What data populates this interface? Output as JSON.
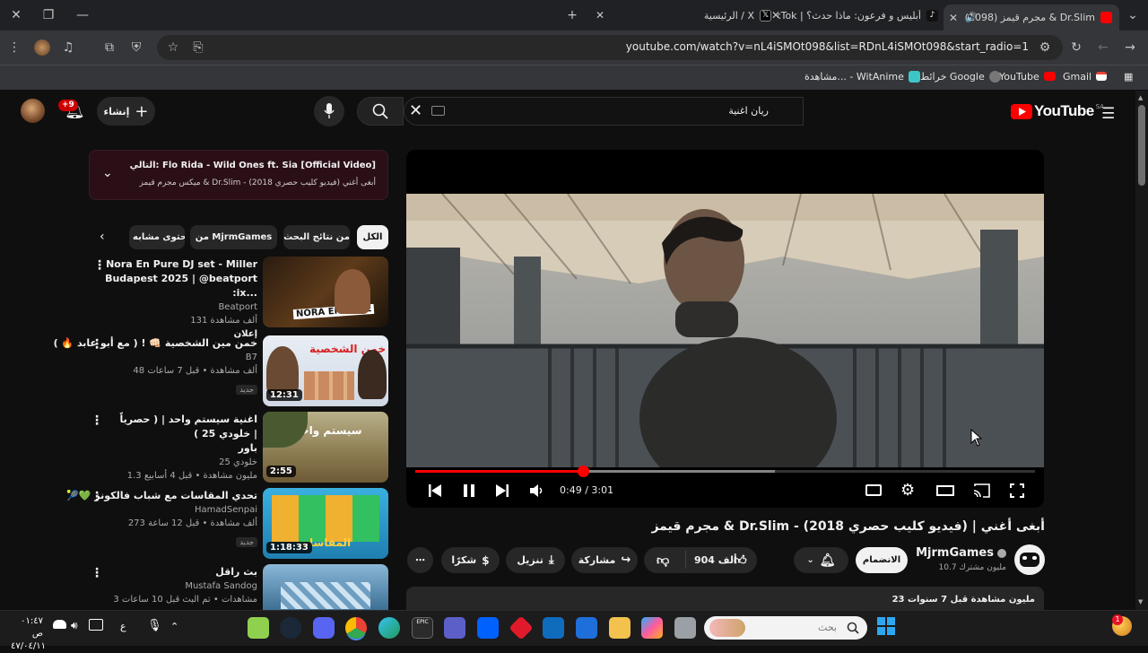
{
  "browser": {
    "tabs": [
      {
        "label": "(1098) مجرم قيمز & Dr.Slim",
        "active": true
      },
      {
        "label": "أبليس و فرعون: ماذا حدث؟ | TikTok"
      },
      {
        "label": "الرئيسية / X"
      }
    ],
    "url": "youtube.com/watch?v=nL4iSMOt098&list=RDnL4iSMOt098&start_radio=1",
    "bookmarks": [
      "Gmail",
      "YouTube",
      "خرائط Google",
      "مشاهدة... - WitAnime"
    ]
  },
  "youtube": {
    "logo_text": "YouTube",
    "region": "SA",
    "search_query": "ريان اغنية",
    "create_label": "إنشاء",
    "notif_count": "+9"
  },
  "player": {
    "time": "0:49 / 3:01",
    "progress": 0.27,
    "buffered": 0.58
  },
  "video": {
    "title": "مجرم قيمز & Dr.Slim - أبغى أغني | (فيديو كليب حصري 2018)",
    "channel": "MjrmGames",
    "subscribers": "10.7 مليون مشترك",
    "subscribe_label": "الانضمام",
    "likes": "904 ألف",
    "share_label": "مشاركة",
    "download_label": "تنزيل",
    "thanks_label": "شكرًا",
    "views": "23 مليون مشاهدة  قبل 7 سنوات"
  },
  "up_next": {
    "title": "التالي: Flo Rida - Wild Ones ft. Sia [Official Video]",
    "subtitle": "ميكس مجرم قيمز & Dr.Slim - أبغى أغني (فيديو كليب حصري 2018)"
  },
  "chips": [
    "الكل",
    "من نتائج البحث",
    "من MjrmGames",
    "محتوى مشابه"
  ],
  "recommendations": [
    {
      "title1": "Nora En Pure DJ set - Miller",
      "title2": "Budapest 2025 | @beatport :ix...",
      "channel": "Beatport",
      "meta": "131 ألف مشاهدة",
      "badge": "إعلان",
      "duration": "",
      "thumb_text": "NORA EN PURE"
    },
    {
      "title1": "خمن مين الشخصية 👊🏻 ! ( مع أبو عابد 🔥 )",
      "title2": "",
      "channel": "B7",
      "meta": "48 ألف مشاهدة • قبل 7 ساعات",
      "badge": "جديد",
      "duration": "12:31",
      "thumb_text": "خمن الشخصية"
    },
    {
      "title1": "اغنية سيستم واحد | ( حصرياً خلودي 25 ) |",
      "title2": "باور",
      "channel": "خلودي 25",
      "meta": "1.3 مليون مشاهدة • قبل 4 أسابيع",
      "badge": "",
      "duration": "2:55",
      "thumb_text": "سيستم واحد"
    },
    {
      "title1": "تحدي المقاسات مع شباب فالكونز 💚🎾",
      "title2": "",
      "channel": "HamadSenpai",
      "meta": "273 ألف مشاهدة • قبل 12 ساعة",
      "badge": "جديد",
      "duration": "1:18:33",
      "thumb_text": "المقاسات"
    },
    {
      "title1": "بث راقل",
      "title2": "",
      "channel": "Mustafa Sandog",
      "meta": "3 مشاهدات • تم البث قبل 10 ساعات",
      "badge": "",
      "duration": "",
      "thumb_text": ""
    }
  ],
  "taskbar": {
    "search_placeholder": "بحث",
    "lang": "ع",
    "time": "٠١:٤٧ ص",
    "date": "٤٧/٠٤/١١",
    "tray_badge": "1"
  },
  "colors": {
    "accent": "#ff0000",
    "bg": "#0f0f0f",
    "chip": "#272727"
  }
}
